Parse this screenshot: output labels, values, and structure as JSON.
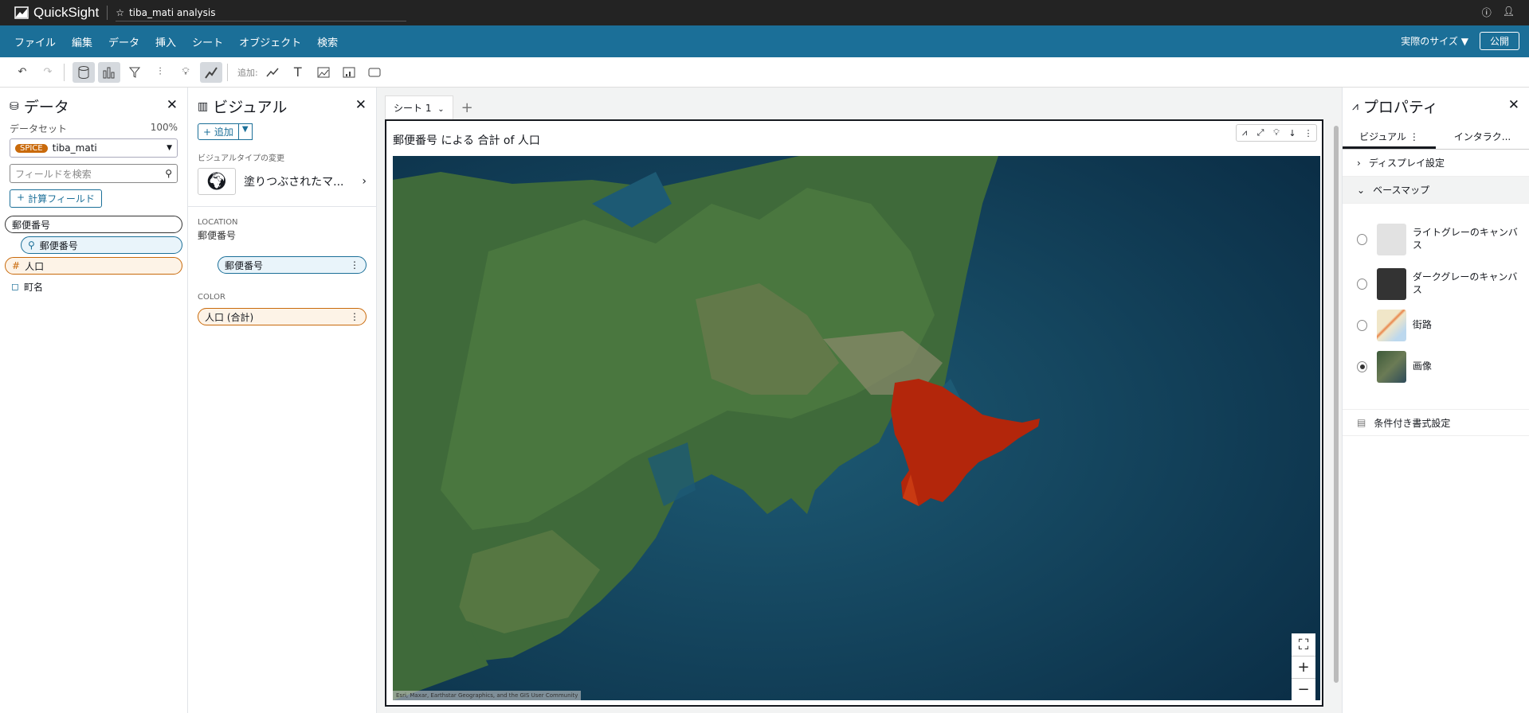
{
  "app": {
    "name": "QuickSight",
    "analysis_title": "tiba_mati analysis"
  },
  "menu": {
    "items": [
      "ファイル",
      "編集",
      "データ",
      "挿入",
      "シート",
      "オブジェクト",
      "検索"
    ],
    "size_label": "実際のサイズ",
    "publish_label": "公開"
  },
  "toolbar": {
    "add_label": "追加:"
  },
  "data_panel": {
    "title": "データ",
    "dataset_label": "データセット",
    "dataset_pct": "100%",
    "spice_badge": "SPICE",
    "dataset_name": "tiba_mati",
    "search_placeholder": "フィールドを検索",
    "calc_field_label": "計算フィールド",
    "fields": [
      {
        "label": "郵便番号",
        "type": "group"
      },
      {
        "label": "郵便番号",
        "type": "geo"
      },
      {
        "label": "人口",
        "type": "measure"
      },
      {
        "label": "町名",
        "type": "dimension"
      }
    ]
  },
  "visual_panel": {
    "title": "ビジュアル",
    "add_label": "追加",
    "type_change_label": "ビジュアルタイプの変更",
    "type_name": "塗りつぶされたマ...",
    "location_label": "LOCATION",
    "location_sub": "郵便番号",
    "location_field": "郵便番号",
    "color_label": "COLOR",
    "color_field": "人口 (合計)"
  },
  "sheet": {
    "tab_label": "シート 1"
  },
  "visual": {
    "title": "郵便番号 による 合計 of 人口",
    "attribution": "Esri, Maxar, Earthstar Geographics, and the GIS User Community"
  },
  "properties": {
    "title": "プロパティ",
    "tab_visual": "ビジュアル",
    "tab_interaction": "インタラク...",
    "display_settings": "ディスプレイ設定",
    "basemap": "ベースマップ",
    "basemaps": [
      {
        "label": "ライトグレーのキャンバス",
        "selected": false
      },
      {
        "label": "ダークグレーのキャンバス",
        "selected": false
      },
      {
        "label": "街路",
        "selected": false
      },
      {
        "label": "画像",
        "selected": true
      }
    ],
    "conditional_formatting": "条件付き書式設定"
  },
  "colors": {
    "topbar": "#232323",
    "menubar": "#1b6f98",
    "region": "#b3260b",
    "spice": "#c96a0b"
  }
}
